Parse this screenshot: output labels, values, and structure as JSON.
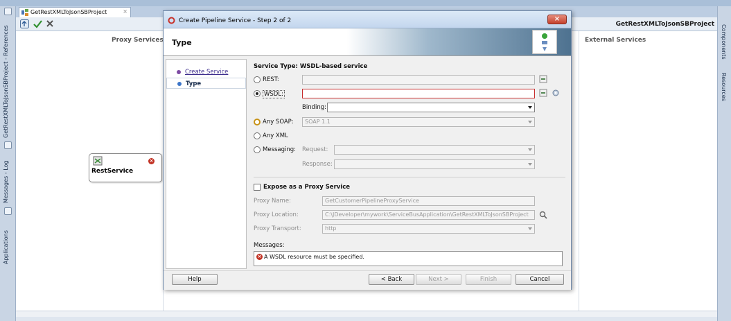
{
  "editor": {
    "tab_title": "GetRestXMLToJsonSBProject",
    "project_title": "GetRestXMLToJsonSBProject",
    "lanes": {
      "proxy": "Proxy Services",
      "external": "External Services"
    },
    "service_node": "RestService"
  },
  "left_rail": {
    "items": [
      "GetRestXMLToJsonSBProject - References",
      "Messages - Log",
      "Applications"
    ]
  },
  "right_rail": {
    "items": [
      "Components",
      "Resources"
    ]
  },
  "dialog": {
    "title": "Create Pipeline Service - Step 2 of 2",
    "header": "Type",
    "nav": [
      {
        "label": "Create Service"
      },
      {
        "label": "Type"
      }
    ],
    "service_type": "Service Type: WSDL-based service",
    "rest_label": "REST:",
    "wsdl_label": "WSDL:",
    "binding_label": "Binding:",
    "any_soap_label": "Any SOAP:",
    "any_soap_value": "SOAP 1.1",
    "any_xml_label": "Any XML",
    "messaging_label": "Messaging:",
    "request_label": "Request:",
    "response_label": "Response:",
    "expose_label": "Expose as a Proxy Service",
    "proxy_name_label": "Proxy Name:",
    "proxy_name_value": "GetCustomerPipelineProxyService",
    "proxy_location_label": "Proxy Location:",
    "proxy_location_value": "C:\\JDeveloper\\mywork\\ServiceBusApplication\\GetRestXMLToJsonSBProject",
    "proxy_transport_label": "Proxy Transport:",
    "proxy_transport_value": "http",
    "messages_label": "Messages:",
    "message_text": "A WSDL resource must be specified.",
    "buttons": {
      "help": "Help",
      "back": "< Back",
      "next": "Next >",
      "finish": "Finish",
      "cancel": "Cancel"
    }
  }
}
